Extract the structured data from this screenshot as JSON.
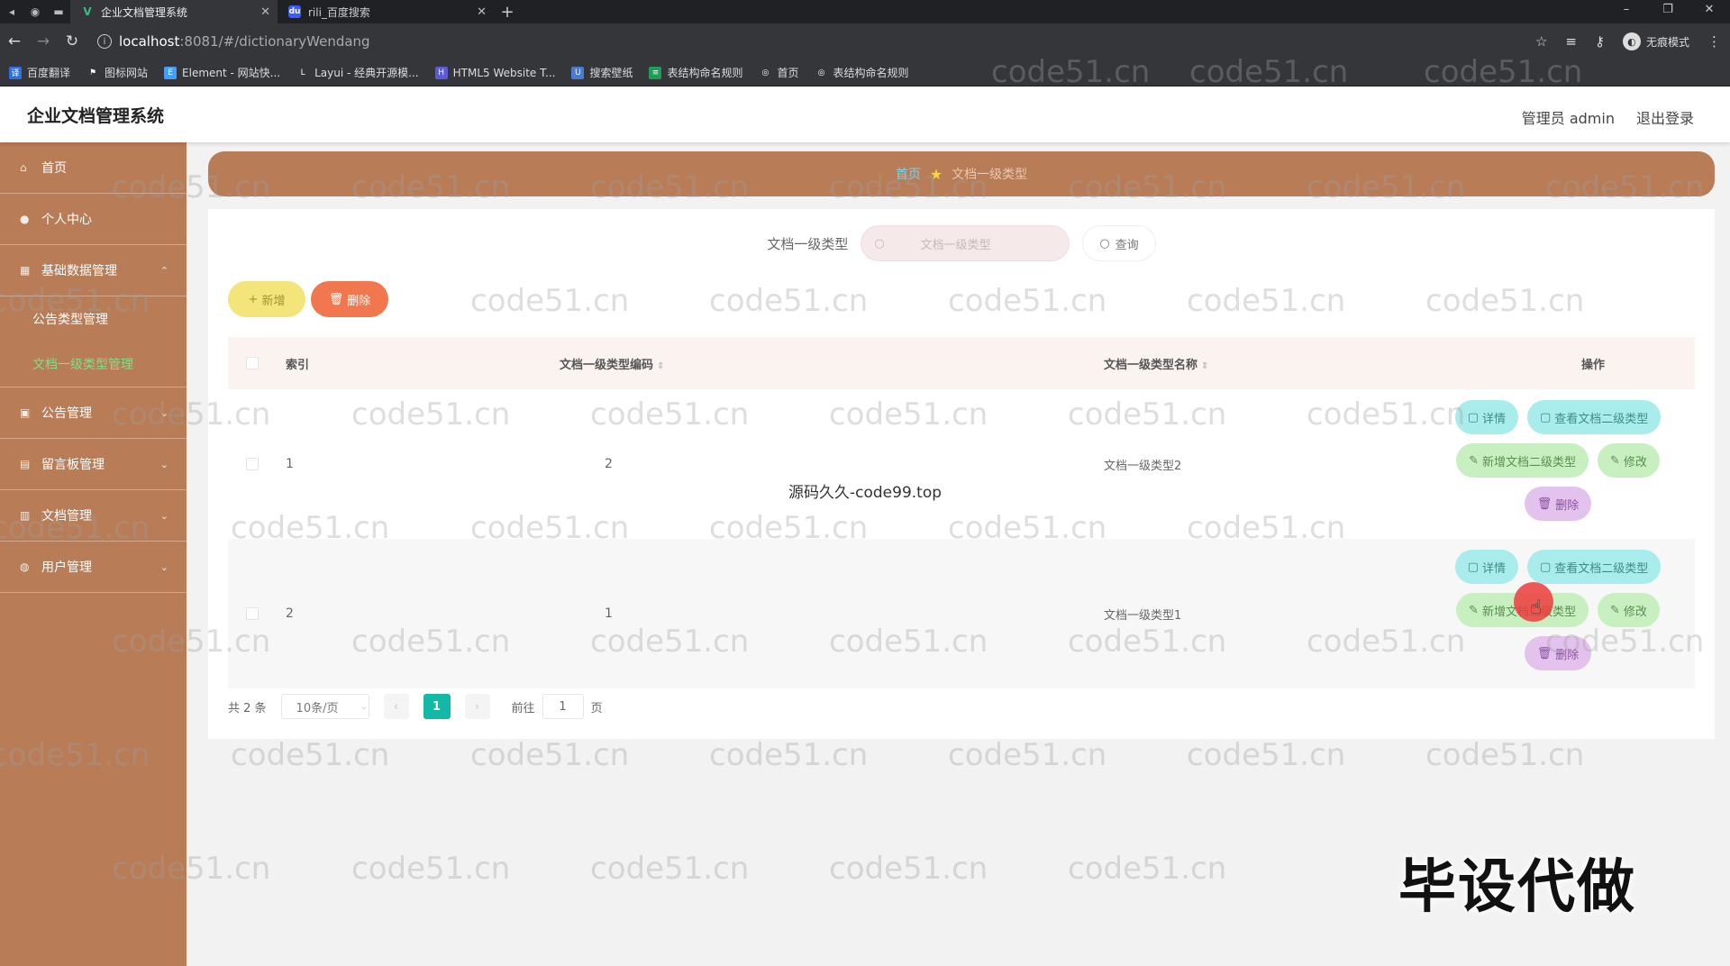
{
  "browser": {
    "tabs": [
      {
        "title": "企业文档管理系统",
        "active": true
      },
      {
        "title": "rili_百度搜索",
        "active": false
      }
    ],
    "url_host": "localhost",
    "url_rest": ":8081/#/dictionaryWendang",
    "profile_label": "无痕模式",
    "bookmarks": [
      "百度翻译",
      "图标网站",
      "Element - 网站快...",
      "Layui - 经典开源模...",
      "HTML5 Website T...",
      "搜索壁纸",
      "表结构命名规则",
      "首页",
      "表结构命名规则"
    ]
  },
  "app": {
    "title": "企业文档管理系统",
    "user_label": "管理员 admin",
    "logout_label": "退出登录"
  },
  "sidebar": {
    "items": [
      {
        "label": "首页",
        "icon": "home-icon"
      },
      {
        "label": "个人中心",
        "icon": "user-icon"
      },
      {
        "label": "基础数据管理",
        "icon": "grid-icon"
      },
      {
        "label": "公告管理",
        "icon": "notice-icon"
      },
      {
        "label": "留言板管理",
        "icon": "message-icon"
      },
      {
        "label": "文档管理",
        "icon": "document-icon"
      },
      {
        "label": "用户管理",
        "icon": "users-icon"
      }
    ],
    "submenu": [
      {
        "label": "公告类型管理",
        "active": false
      },
      {
        "label": "文档一级类型管理",
        "active": true
      }
    ]
  },
  "breadcrumb": {
    "home": "首页",
    "current": "文档一级类型"
  },
  "search": {
    "label": "文档一级类型",
    "placeholder": "文档一级类型",
    "button": "查询"
  },
  "actions": {
    "add": "新增",
    "delete": "删除"
  },
  "table": {
    "columns": [
      "索引",
      "文档一级类型编码",
      "文档一级类型名称",
      "操作"
    ],
    "rows": [
      {
        "index": "1",
        "code": "2",
        "name": "文档一级类型2"
      },
      {
        "index": "2",
        "code": "1",
        "name": "文档一级类型1"
      }
    ],
    "row_actions": {
      "detail": "详情",
      "view_sub": "查看文档二级类型",
      "add_sub": "新增文档二级类型",
      "edit": "修改",
      "delete": "删除"
    }
  },
  "pagination": {
    "total": "共 2 条",
    "page_size": "10条/页",
    "current_page": "1",
    "goto_prefix": "前往",
    "goto_value": "1",
    "goto_suffix": "页"
  },
  "overlays": {
    "watermark": "code51.cn",
    "mid_text": "源码久久-code99.top",
    "big_text": "毕设代做"
  },
  "colors": {
    "sidebar_bg": "#b87c57",
    "accent_green": "#14b8a6",
    "active_submenu": "#7ee08a"
  }
}
